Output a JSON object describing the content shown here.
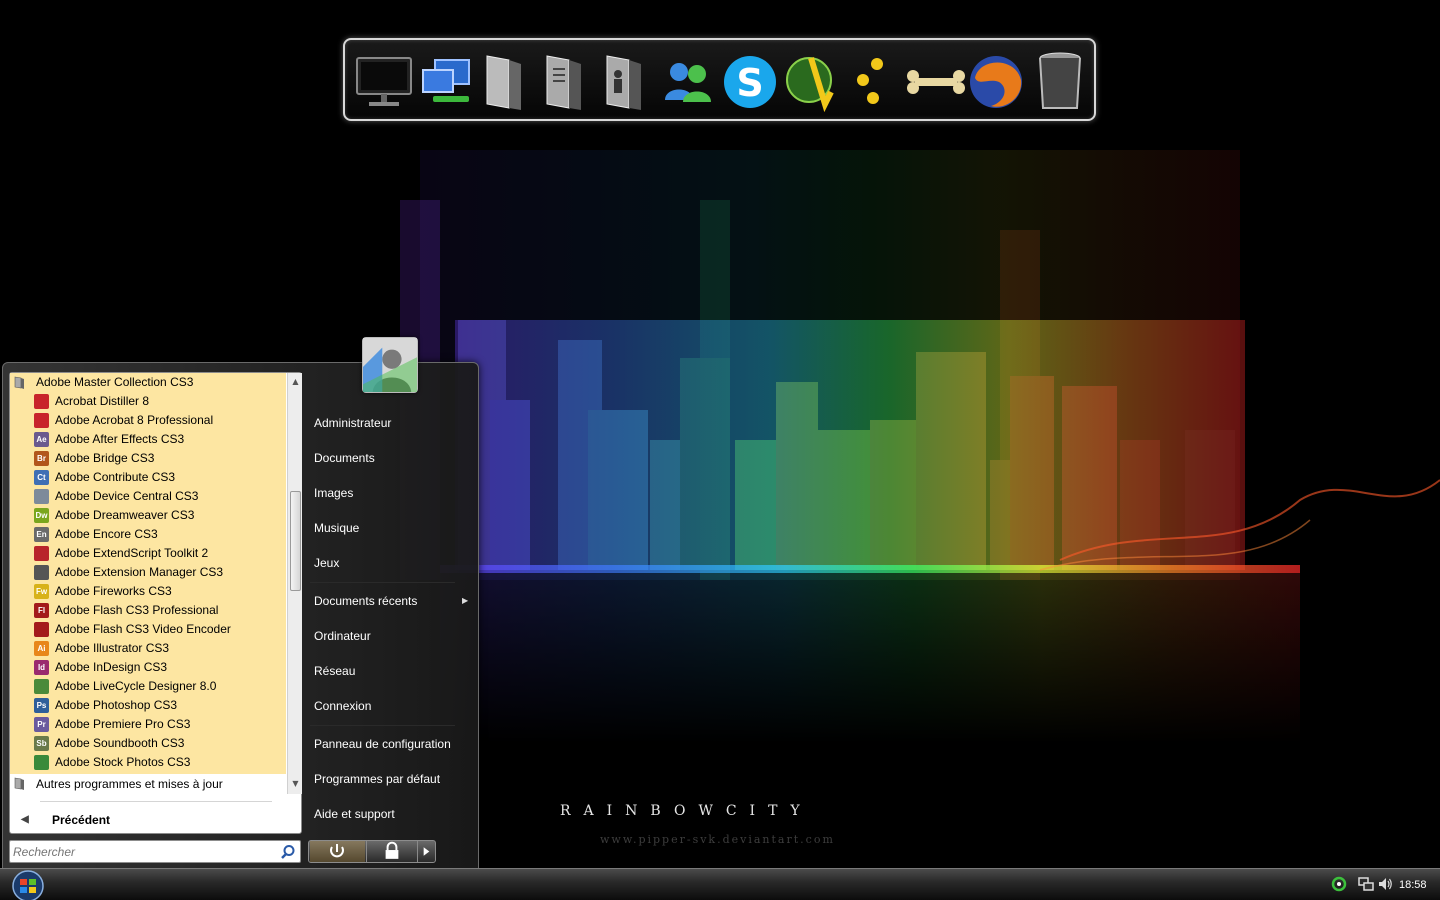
{
  "wallpaper": {
    "title": "RAINBOWCITY",
    "url": "www.pipper-svk.deviantart.com"
  },
  "dock": {
    "icons": [
      {
        "name": "monitor-icon"
      },
      {
        "name": "network-icon"
      },
      {
        "name": "folder-icon"
      },
      {
        "name": "documents-folder-icon"
      },
      {
        "name": "user-folder-icon"
      },
      {
        "name": "messenger-icon"
      },
      {
        "name": "skype-icon"
      },
      {
        "name": "browser-globe-icon"
      },
      {
        "name": "three-dots-icon"
      },
      {
        "name": "bone-icon"
      },
      {
        "name": "firefox-icon"
      },
      {
        "name": "trash-icon"
      }
    ]
  },
  "start_menu": {
    "programs": [
      {
        "label": "Adobe Master Collection CS3",
        "icon": "folder-icon",
        "abbr": "",
        "color": "#8a8a8a",
        "folder": true
      },
      {
        "label": "Acrobat Distiller 8",
        "icon": "acrobat-distiller-icon",
        "abbr": "",
        "color": "#c8242b"
      },
      {
        "label": "Adobe Acrobat 8 Professional",
        "icon": "acrobat-icon",
        "abbr": "",
        "color": "#c8242b"
      },
      {
        "label": "Adobe After Effects CS3",
        "icon": "after-effects-icon",
        "abbr": "Ae",
        "color": "#6a5a8e"
      },
      {
        "label": "Adobe Bridge CS3",
        "icon": "bridge-icon",
        "abbr": "Br",
        "color": "#b2561b"
      },
      {
        "label": "Adobe Contribute CS3",
        "icon": "contribute-icon",
        "abbr": "Ct",
        "color": "#3f6fb4"
      },
      {
        "label": "Adobe Device Central CS3",
        "icon": "device-central-icon",
        "abbr": "",
        "color": "#7d8a9a"
      },
      {
        "label": "Adobe Dreamweaver CS3",
        "icon": "dreamweaver-icon",
        "abbr": "Dw",
        "color": "#7aa61d"
      },
      {
        "label": "Adobe Encore CS3",
        "icon": "encore-icon",
        "abbr": "En",
        "color": "#6a6a6a"
      },
      {
        "label": "Adobe ExtendScript Toolkit 2",
        "icon": "extendscript-icon",
        "abbr": "",
        "color": "#b8242b"
      },
      {
        "label": "Adobe Extension Manager CS3",
        "icon": "extension-manager-icon",
        "abbr": "",
        "color": "#555555"
      },
      {
        "label": "Adobe Fireworks CS3",
        "icon": "fireworks-icon",
        "abbr": "Fw",
        "color": "#d8b21a"
      },
      {
        "label": "Adobe Flash CS3 Professional",
        "icon": "flash-icon",
        "abbr": "Fl",
        "color": "#a31b1b"
      },
      {
        "label": "Adobe Flash CS3 Video Encoder",
        "icon": "flash-encoder-icon",
        "abbr": "",
        "color": "#a31b1b"
      },
      {
        "label": "Adobe Illustrator CS3",
        "icon": "illustrator-icon",
        "abbr": "Ai",
        "color": "#e8871a"
      },
      {
        "label": "Adobe InDesign CS3",
        "icon": "indesign-icon",
        "abbr": "Id",
        "color": "#9a2a6e"
      },
      {
        "label": "Adobe LiveCycle Designer 8.0",
        "icon": "livecycle-icon",
        "abbr": "",
        "color": "#4a8a3a"
      },
      {
        "label": "Adobe Photoshop CS3",
        "icon": "photoshop-icon",
        "abbr": "Ps",
        "color": "#2f5f9a"
      },
      {
        "label": "Adobe Premiere Pro CS3",
        "icon": "premiere-icon",
        "abbr": "Pr",
        "color": "#6a5a9e"
      },
      {
        "label": "Adobe Soundbooth CS3",
        "icon": "soundbooth-icon",
        "abbr": "Sb",
        "color": "#6a7a4a"
      },
      {
        "label": "Adobe Stock Photos CS3",
        "icon": "stock-photos-icon",
        "abbr": "",
        "color": "#3a8a3a"
      }
    ],
    "other_programs": "Autres programmes et mises à jour",
    "back": "Précédent",
    "search": {
      "placeholder": "Rechercher",
      "value": ""
    },
    "right_items": {
      "user": "Administrateur",
      "documents": "Documents",
      "images": "Images",
      "music": "Musique",
      "games": "Jeux",
      "recent": "Documents récents",
      "computer": "Ordinateur",
      "network": "Réseau",
      "connect": "Connexion",
      "control_panel": "Panneau de configuration",
      "default_programs": "Programmes par défaut",
      "help": "Aide et support"
    }
  },
  "taskbar": {
    "clock": "18:58",
    "tray_icons": [
      "status-ring-icon",
      "network-tray-icon",
      "volume-icon"
    ]
  }
}
